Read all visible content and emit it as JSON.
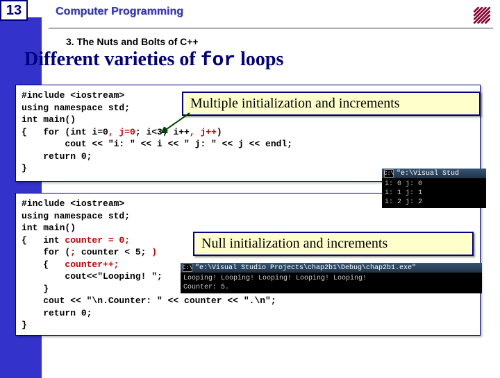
{
  "page_number": "13",
  "course_title": "Computer Programming",
  "chapter": "3. The Nuts and Bolts of C++",
  "slide_title_pre": "Different varieties of ",
  "slide_title_mono": "for",
  "slide_title_post": " loops",
  "code1": {
    "l1": "#include <iostream>",
    "l2": "using namespace std;",
    "l3": "int main()",
    "l4a": "{   for (int i=0",
    "l4b": ", j=0",
    "l4c": "; i<3; i++",
    "l4d": ", j++",
    "l4e": ")",
    "l5": "        cout << \"i: \" << i << \" j: \" << j << endl;",
    "l6": "    return 0;",
    "l7": "}"
  },
  "callout1": "Multiple initialization and increments",
  "code2": {
    "l1": "#include <iostream>",
    "l2": "using namespace std;",
    "l3": "int main()",
    "l4a": "{   int ",
    "l4b": "counter = 0;",
    "l5a": "    for (",
    "l5b": ";",
    "l5c": " counter < 5; ",
    "l5d": ")",
    "l6a": "    {   ",
    "l6b": "counter++;",
    "l7": "        cout<<\"Looping! \";",
    "l8": "    }",
    "l9": "    cout << \"\\n.Counter: \" << counter << \".\\n\";",
    "l10": "    return 0;",
    "l11": "}"
  },
  "callout2": "Null initialization and increments",
  "console1": {
    "title": "\"e:\\Visual Stud",
    "out": "i: 0 j: 0\ni: 1 j: 1\ni: 2 j: 2"
  },
  "console2": {
    "title": "\"e:\\Visual Studio Projects\\chap2b1\\Debug\\chap2b1.exe\"",
    "out": "Looping! Looping! Looping! Looping! Looping!\nCounter: 5."
  }
}
